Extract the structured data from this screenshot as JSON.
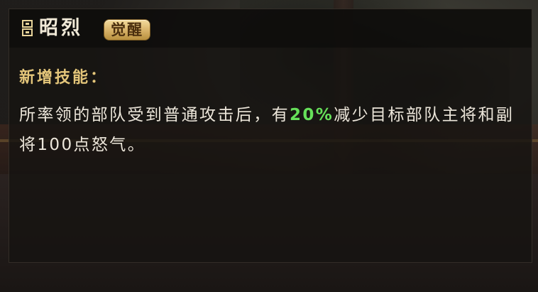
{
  "tooltip": {
    "hero_name": "昭烈",
    "badge": "觉醒",
    "section_label": "新增技能：",
    "description": {
      "part1": "所率领的部队受到普通攻击后，有",
      "highlight": "20%",
      "part2": "减少目标部队主将和副将100点怒气。"
    }
  },
  "colors": {
    "highlight": "#66e05a",
    "section_label": "#e4c67a",
    "badge_bg": "#d6b066"
  },
  "icons": {
    "hero_icon": "hero-sigil-icon"
  }
}
